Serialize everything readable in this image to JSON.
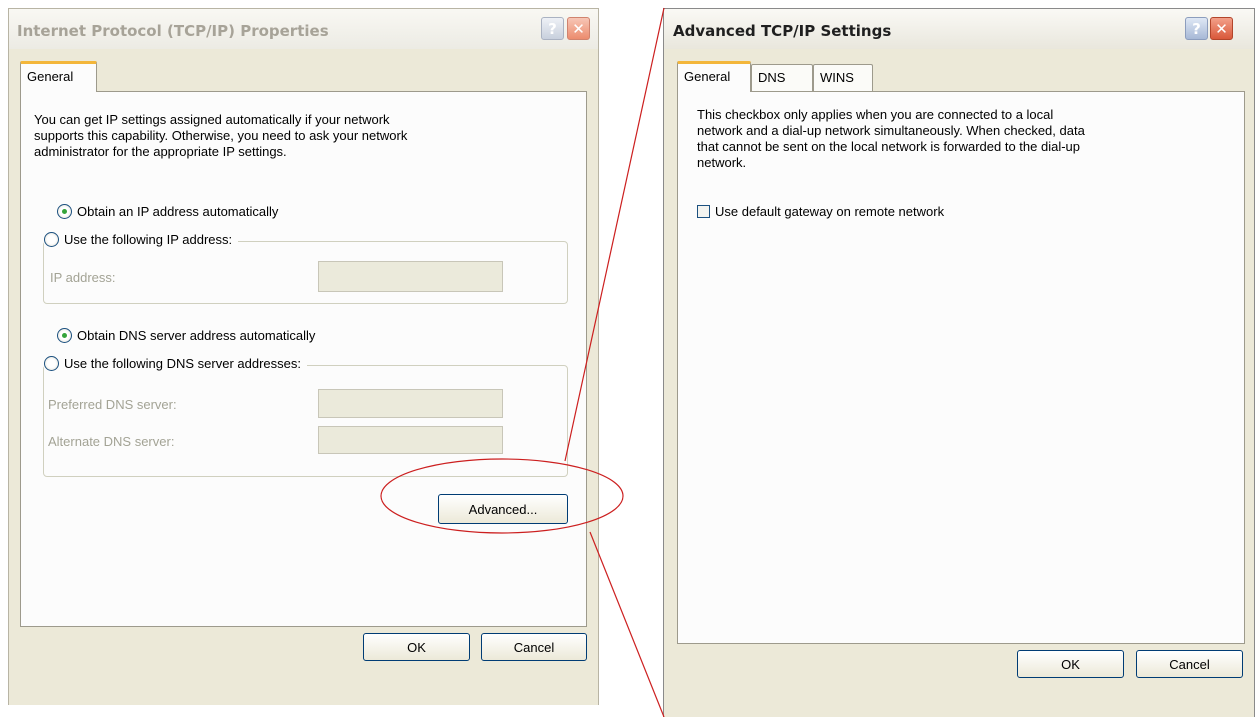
{
  "left_dialog": {
    "title": "Internet Protocol (TCP/IP) Properties",
    "help_glyph": "?",
    "close_glyph": "✕",
    "tab_general": "General",
    "intro_lines": [
      "You can get IP settings assigned automatically if your network",
      "supports this capability. Otherwise, you need to ask your network",
      "administrator for the appropriate IP settings."
    ],
    "radio_obtain_ip": "Obtain an IP address automatically",
    "radio_use_ip": "Use the following IP address:",
    "label_ip_address": "IP address:",
    "radio_obtain_dns": "Obtain DNS server address automatically",
    "radio_use_dns": "Use the following DNS server addresses:",
    "label_preferred_dns": "Preferred DNS server:",
    "label_alternate_dns": "Alternate DNS server:",
    "advanced_button": "Advanced...",
    "ok_button": "OK",
    "cancel_button": "Cancel"
  },
  "right_dialog": {
    "title": "Advanced TCP/IP Settings",
    "help_glyph": "?",
    "close_glyph": "✕",
    "tabs": [
      "General",
      "DNS",
      "WINS"
    ],
    "info_lines": [
      "This checkbox only applies when you are connected to a local",
      "network and a dial-up network simultaneously.  When checked, data",
      "that cannot be sent on the local network is forwarded to the dial-up",
      "network."
    ],
    "checkbox_gateway": "Use default gateway on remote network",
    "ok_button": "OK",
    "cancel_button": "Cancel"
  },
  "colors": {
    "annotation": "#cc1f1f",
    "tab_highlight": "#f3b63a",
    "radio_dot": "#35a43a"
  }
}
